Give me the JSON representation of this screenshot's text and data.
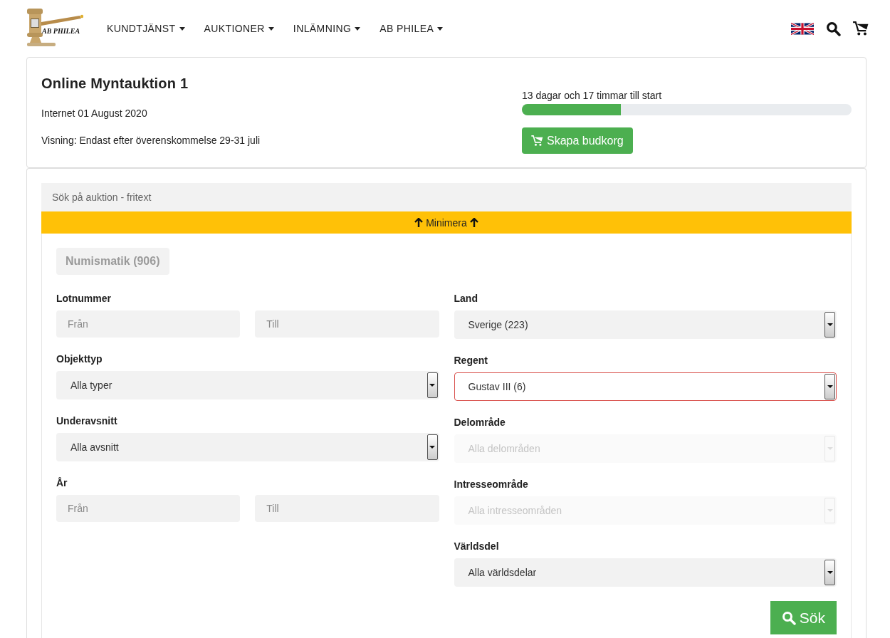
{
  "header": {
    "logo_text": "AB PHILEA",
    "nav": [
      {
        "label": "KUNDTJÄNST"
      },
      {
        "label": "AUKTIONER"
      },
      {
        "label": "INLÄMNING"
      },
      {
        "label": "AB PHILEA"
      }
    ]
  },
  "auction": {
    "title": "Online Myntauktion 1",
    "date": "Internet 01 August 2020",
    "viewing": "Visning: Endast efter överenskommelse 29-31 juli",
    "countdown": "13 dagar och 17 timmar till start",
    "level": 0.3,
    "button": "Skapa budkorg"
  },
  "search": {
    "placeholder": "Sök på auktion - fritext",
    "collapse_label": "Minimera",
    "category": "Numismatik (906)",
    "left_fields": [
      {
        "kind": "range",
        "label": "Lotnummer",
        "from_placeholder": "Från",
        "to_placeholder": "Till"
      },
      {
        "kind": "select",
        "label": "Objekttyp",
        "value": "Alla typer",
        "disabled": false,
        "highlighted": false
      },
      {
        "kind": "select",
        "label": "Underavsnitt",
        "value": "Alla avsnitt",
        "disabled": false,
        "highlighted": false
      },
      {
        "kind": "range",
        "label": "År",
        "from_placeholder": "Från",
        "to_placeholder": "Till"
      }
    ],
    "right_fields": [
      {
        "kind": "select",
        "label": "Land",
        "value": "Sverige (223)",
        "disabled": false,
        "highlighted": false
      },
      {
        "kind": "select",
        "label": "Regent",
        "value": "Gustav III (6)",
        "disabled": false,
        "highlighted": true
      },
      {
        "kind": "select",
        "label": "Delområde",
        "value": "Alla delområden",
        "disabled": true,
        "highlighted": false
      },
      {
        "kind": "select",
        "label": "Intresseområde",
        "value": "Alla intresseområden",
        "disabled": true,
        "highlighted": false
      },
      {
        "kind": "select",
        "label": "Världsdel",
        "value": "Alla världsdelar",
        "disabled": false,
        "highlighted": false
      }
    ],
    "submit": "Sök"
  }
}
